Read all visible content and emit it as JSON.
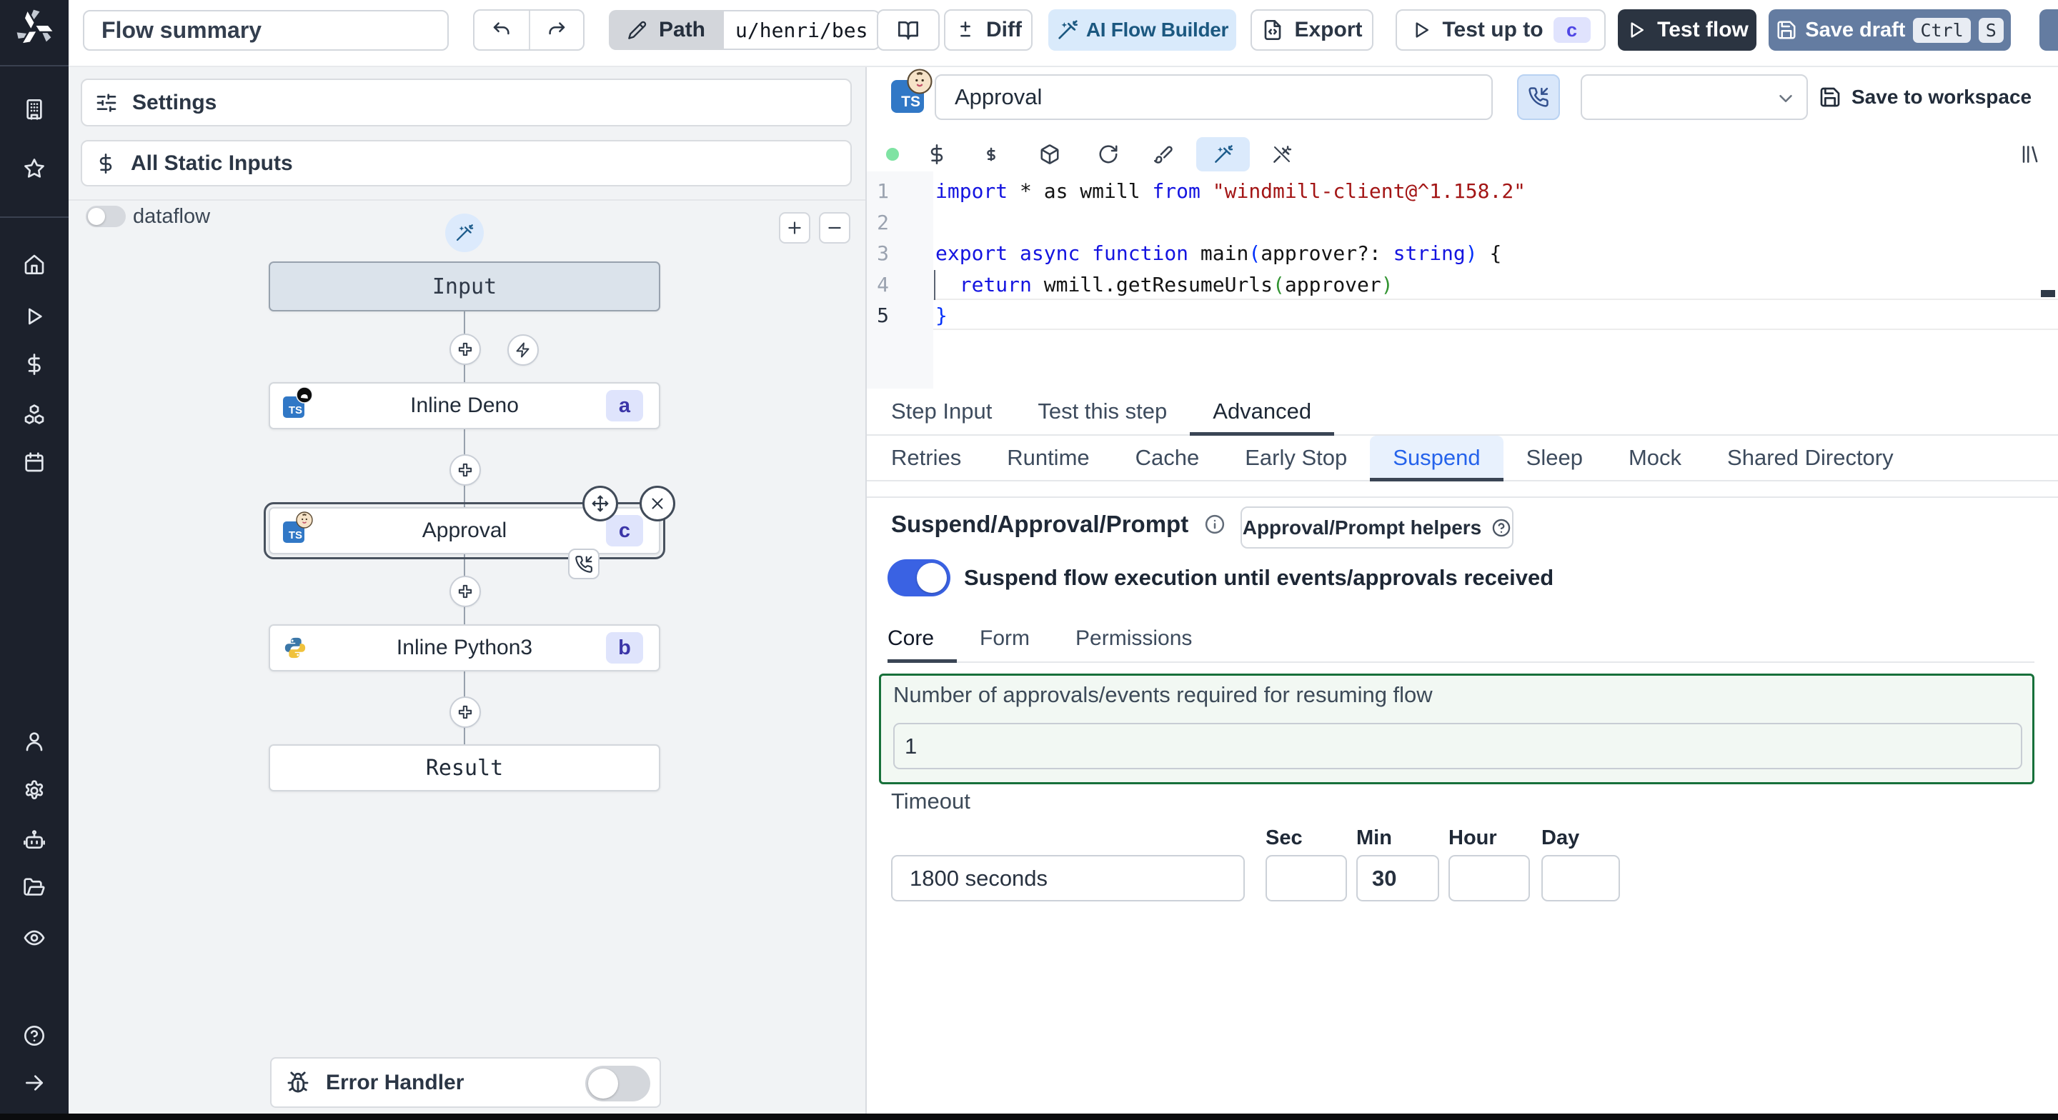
{
  "topbar": {
    "flow_summary": "Flow summary",
    "path_label": "Path",
    "path_value": "u/henri/bes",
    "diff_label": "Diff",
    "ai_flow_builder_label": "AI Flow Builder",
    "export_label": "Export",
    "test_up_to_label": "Test up to",
    "test_up_to_badge": "c",
    "test_flow_label": "Test flow",
    "save_draft_label": "Save draft",
    "kbd_ctrl": "Ctrl",
    "kbd_s": "S"
  },
  "sidebar": {
    "icons_top": [
      "building",
      "star"
    ],
    "icons_main": [
      "home",
      "play",
      "dollar",
      "boxes",
      "calendar"
    ],
    "icons_lower": [
      "user",
      "gear",
      "bot",
      "folder-open",
      "eye"
    ],
    "icons_footer": [
      "help-circle",
      "arrow-right"
    ]
  },
  "flow_panel": {
    "settings_label": "Settings",
    "static_inputs_label": "All Static Inputs",
    "dataflow_label": "dataflow",
    "nodes": {
      "input_label": "Input",
      "deno_label": "Inline Deno",
      "deno_badge": "a",
      "approval_label": "Approval",
      "approval_badge": "c",
      "python_label": "Inline Python3",
      "python_badge": "b",
      "result_label": "Result"
    },
    "error_handler_label": "Error Handler"
  },
  "editor": {
    "step_name": "Approval",
    "save_to_workspace_label": "Save to workspace",
    "language_icon": "typescript",
    "line_numbers": [
      "1",
      "2",
      "3",
      "4",
      "5"
    ],
    "active_line": 5,
    "code_lines": [
      [
        {
          "t": "import",
          "c": "kw"
        },
        {
          "t": " * as wmill ",
          "c": "tx"
        },
        {
          "t": "from",
          "c": "kw"
        },
        {
          "t": " ",
          "c": "tx"
        },
        {
          "t": "\"windmill-client@^1.158.2\"",
          "c": "str"
        }
      ],
      [],
      [
        {
          "t": "export",
          "c": "kw"
        },
        {
          "t": " ",
          "c": "tx"
        },
        {
          "t": "async",
          "c": "kw"
        },
        {
          "t": " ",
          "c": "tx"
        },
        {
          "t": "function",
          "c": "kw"
        },
        {
          "t": " main",
          "c": "tx"
        },
        {
          "t": "(",
          "c": "br1"
        },
        {
          "t": "approver?: ",
          "c": "tx"
        },
        {
          "t": "string",
          "c": "kw"
        },
        {
          "t": ")",
          "c": "br1"
        },
        {
          "t": " {",
          "c": "tx"
        }
      ],
      [
        {
          "t": "  ",
          "c": "tx"
        },
        {
          "t": "return",
          "c": "kw"
        },
        {
          "t": " wmill.getResumeUrls",
          "c": "tx"
        },
        {
          "t": "(",
          "c": "br2"
        },
        {
          "t": "approver",
          "c": "tx"
        },
        {
          "t": ")",
          "c": "br2"
        }
      ],
      [
        {
          "t": "}",
          "c": "br1"
        }
      ]
    ],
    "tabs_primary": [
      "Step Input",
      "Test this step",
      "Advanced"
    ],
    "tabs_primary_active": "Advanced",
    "tabs_advanced": [
      "Retries",
      "Runtime",
      "Cache",
      "Early Stop",
      "Suspend",
      "Sleep",
      "Mock",
      "Shared Directory"
    ],
    "tabs_advanced_active": "Suspend",
    "suspend": {
      "heading": "Suspend/Approval/Prompt",
      "helpers_button_label": "Approval/Prompt helpers",
      "toggle_label": "Suspend flow execution until events/approvals received",
      "toggle_on": true,
      "tabs": [
        "Core",
        "Form",
        "Permissions"
      ],
      "tabs_active": "Core",
      "approvals_label": "Number of approvals/events required for resuming flow",
      "approvals_value": "1",
      "timeout_label": "Timeout",
      "timeout_value": "1800 seconds",
      "unit_labels": [
        "Sec",
        "Min",
        "Hour",
        "Day"
      ],
      "unit_values": [
        "",
        "30",
        "",
        ""
      ]
    }
  },
  "colors": {
    "sidebar_bg": "#1c212c",
    "accent_blue": "#3a62e3",
    "ai_button_bg": "#d9eafb",
    "save_draft_bg": "#647ca1",
    "test_flow_bg": "#2b3441",
    "badge_bg": "#dfe4fc",
    "badge_text": "#3b35a8",
    "green_border": "#17703a",
    "green_bg": "#f2f8f3",
    "suspend_tab_text": "#2563eb",
    "code_keyword": "#1414e0",
    "code_string": "#a31515",
    "code_bracket1": "#0431fa",
    "code_bracket2": "#319331",
    "lsp_dot": "#7fe3a3"
  }
}
